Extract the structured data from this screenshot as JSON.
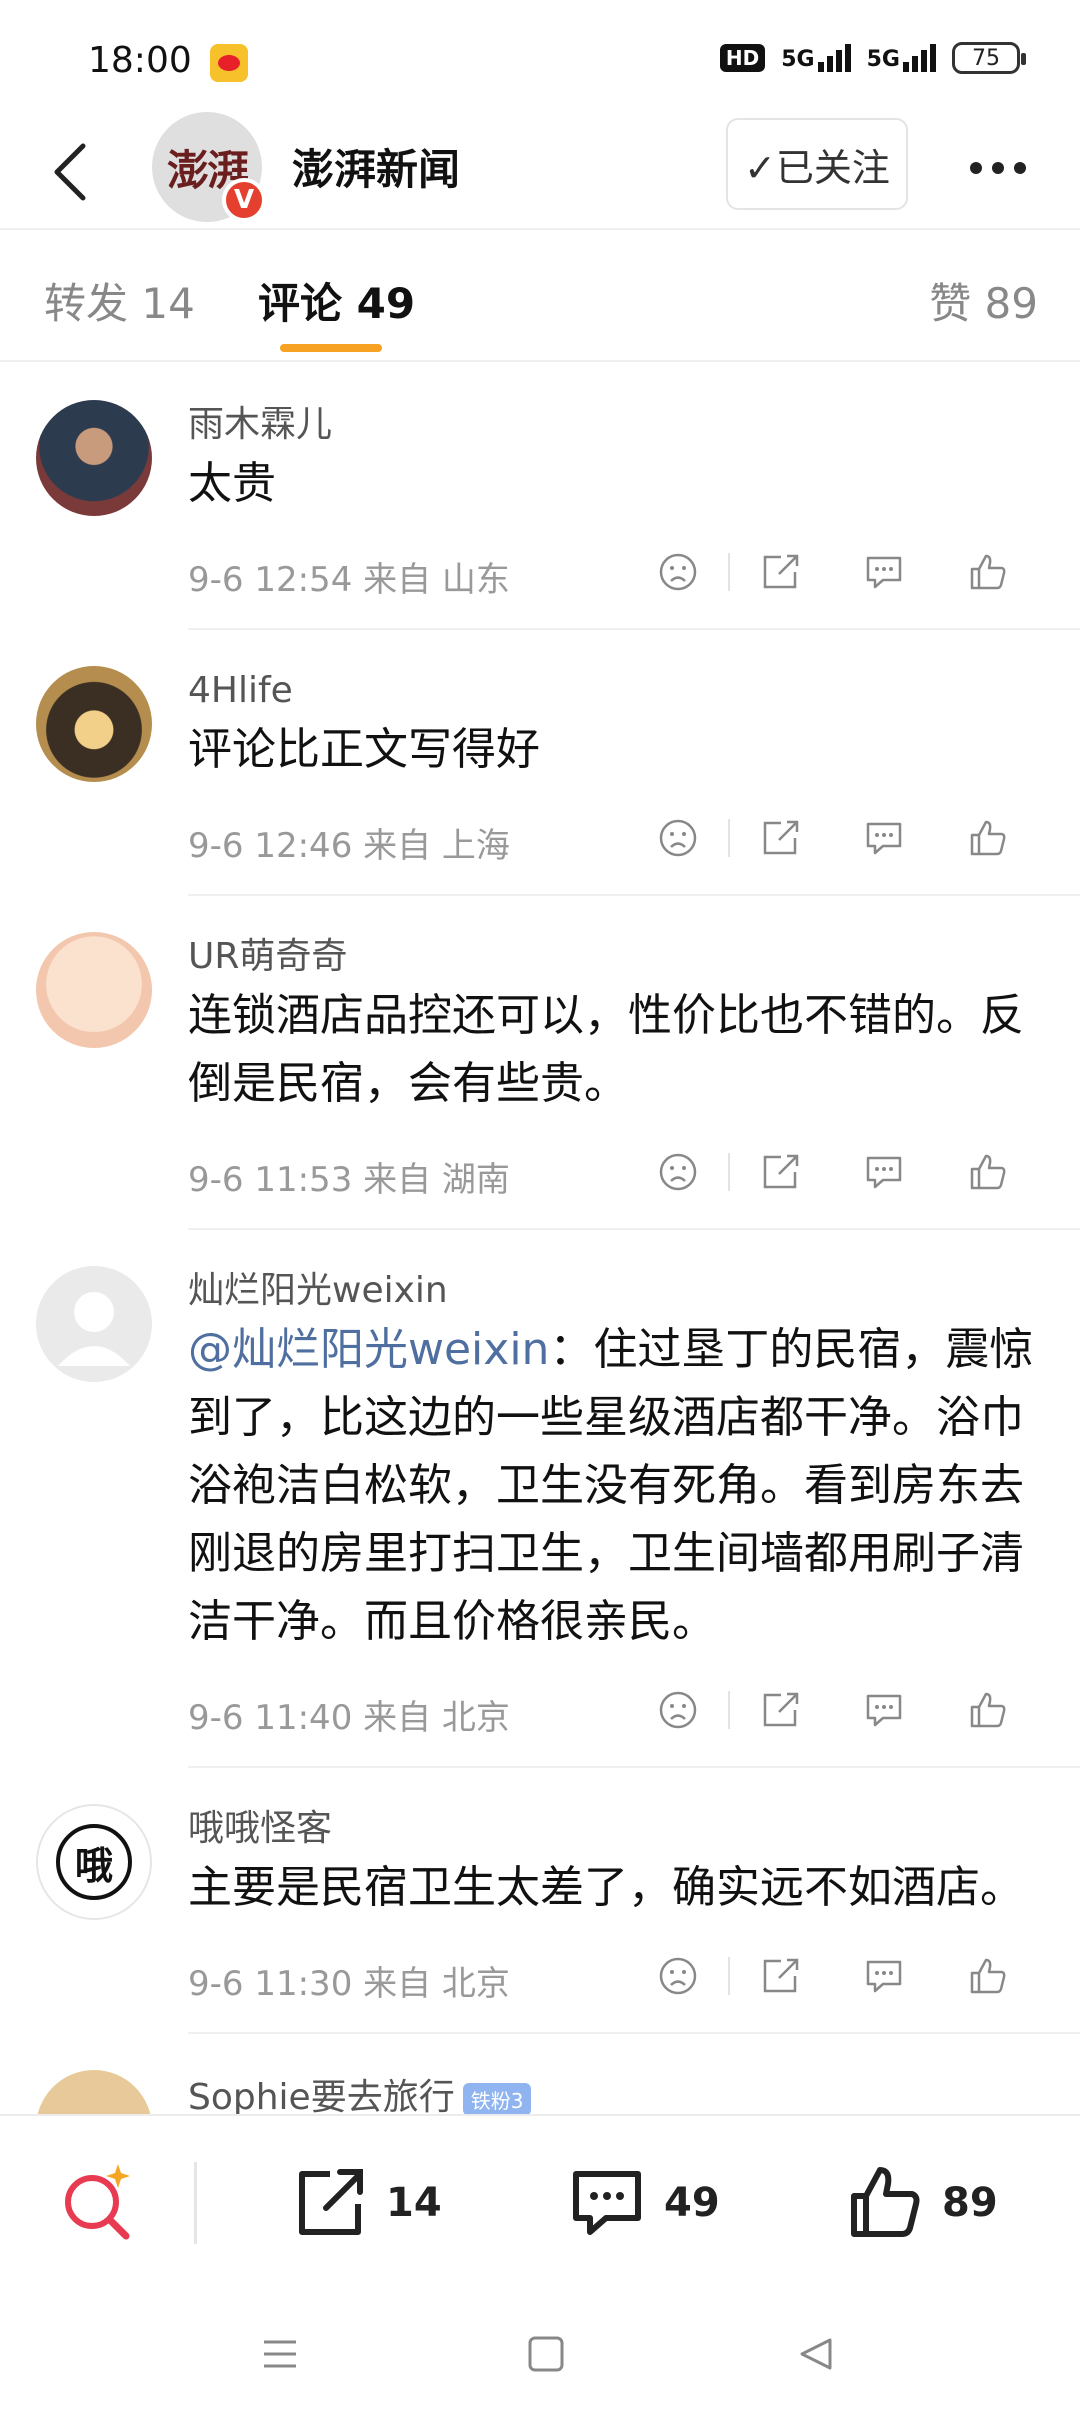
{
  "status_bar": {
    "time": "18:00",
    "hd_label": "HD",
    "signal1": "5G",
    "signal2": "5G",
    "battery": "75"
  },
  "header": {
    "account_name": "澎湃新闻",
    "avatar_text": "澎湃",
    "verified_mark": "V",
    "follow_label": "✓已关注"
  },
  "tabs": {
    "repost": "转发 14",
    "comments": "评论 49",
    "likes": "赞 89"
  },
  "comments": [
    {
      "user": "雨木霖儿",
      "text": "太贵",
      "time": "9-6 12:54  来自 山东"
    },
    {
      "user": "4Hlife",
      "text": "评论比正文写得好",
      "time": "9-6 12:46  来自 上海"
    },
    {
      "user": "UR萌奇奇",
      "text": "连锁酒店品控还可以，性价比也不错的。反倒是民宿，会有些贵。",
      "time": "9-6 11:53  来自 湖南"
    },
    {
      "user": "灿烂阳光weixin",
      "mention": "@灿烂阳光weixin",
      "text": "：住过垦丁的民宿，震惊到了，比这边的一些星级酒店都干净。浴巾浴袍洁白松软，卫生没有死角。看到房东去刚退的房里打扫卫生，卫生间墙都用刷子清洁干净。而且价格很亲民。",
      "time": "9-6 11:40  来自 北京"
    },
    {
      "user": "哦哦怪客",
      "avatar_char": "哦",
      "text": "主要是民宿卫生太差了，确实远不如酒店。",
      "time": "9-6 11:30  来自 北京"
    }
  ],
  "partial_comment": {
    "user": "Sophie要去旅行",
    "badge": "铁粉3"
  },
  "bottom_bar": {
    "repost_count": "14",
    "comment_count": "49",
    "like_count": "89"
  },
  "colors": {
    "accent": "#f8a223",
    "mention": "#4f6fa0",
    "verified": "#e5402f"
  }
}
